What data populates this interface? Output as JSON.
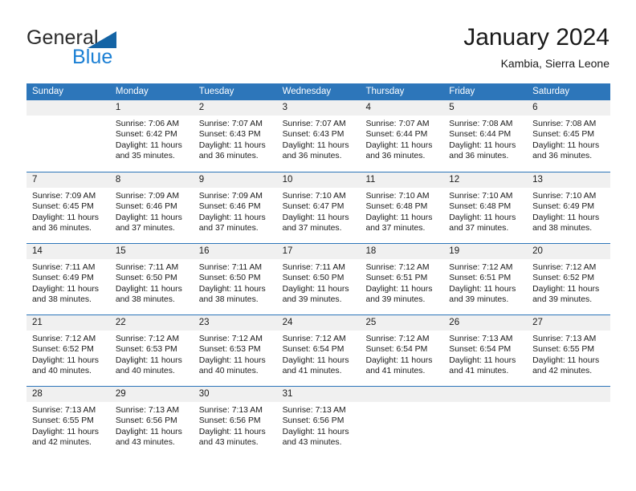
{
  "brand": {
    "line1": "General",
    "line2": "Blue",
    "triangle_color": "#1464a5",
    "line2_color": "#1a7fd4"
  },
  "header": {
    "title": "January 2024",
    "subtitle": "Kambia, Sierra Leone"
  },
  "colors": {
    "header_row_background": "#2d76ba",
    "header_row_text": "#ffffff",
    "day_number_band": "#f0f0f0",
    "week_divider": "#2d76ba",
    "body_text": "#1a1a1a",
    "page_background": "#ffffff"
  },
  "weekday_headers": [
    "Sunday",
    "Monday",
    "Tuesday",
    "Wednesday",
    "Thursday",
    "Friday",
    "Saturday"
  ],
  "weeks": [
    [
      {
        "day": "",
        "lines": []
      },
      {
        "day": "1",
        "lines": [
          "Sunrise: 7:06 AM",
          "Sunset: 6:42 PM",
          "Daylight: 11 hours",
          "and 35 minutes."
        ]
      },
      {
        "day": "2",
        "lines": [
          "Sunrise: 7:07 AM",
          "Sunset: 6:43 PM",
          "Daylight: 11 hours",
          "and 36 minutes."
        ]
      },
      {
        "day": "3",
        "lines": [
          "Sunrise: 7:07 AM",
          "Sunset: 6:43 PM",
          "Daylight: 11 hours",
          "and 36 minutes."
        ]
      },
      {
        "day": "4",
        "lines": [
          "Sunrise: 7:07 AM",
          "Sunset: 6:44 PM",
          "Daylight: 11 hours",
          "and 36 minutes."
        ]
      },
      {
        "day": "5",
        "lines": [
          "Sunrise: 7:08 AM",
          "Sunset: 6:44 PM",
          "Daylight: 11 hours",
          "and 36 minutes."
        ]
      },
      {
        "day": "6",
        "lines": [
          "Sunrise: 7:08 AM",
          "Sunset: 6:45 PM",
          "Daylight: 11 hours",
          "and 36 minutes."
        ]
      }
    ],
    [
      {
        "day": "7",
        "lines": [
          "Sunrise: 7:09 AM",
          "Sunset: 6:45 PM",
          "Daylight: 11 hours",
          "and 36 minutes."
        ]
      },
      {
        "day": "8",
        "lines": [
          "Sunrise: 7:09 AM",
          "Sunset: 6:46 PM",
          "Daylight: 11 hours",
          "and 37 minutes."
        ]
      },
      {
        "day": "9",
        "lines": [
          "Sunrise: 7:09 AM",
          "Sunset: 6:46 PM",
          "Daylight: 11 hours",
          "and 37 minutes."
        ]
      },
      {
        "day": "10",
        "lines": [
          "Sunrise: 7:10 AM",
          "Sunset: 6:47 PM",
          "Daylight: 11 hours",
          "and 37 minutes."
        ]
      },
      {
        "day": "11",
        "lines": [
          "Sunrise: 7:10 AM",
          "Sunset: 6:48 PM",
          "Daylight: 11 hours",
          "and 37 minutes."
        ]
      },
      {
        "day": "12",
        "lines": [
          "Sunrise: 7:10 AM",
          "Sunset: 6:48 PM",
          "Daylight: 11 hours",
          "and 37 minutes."
        ]
      },
      {
        "day": "13",
        "lines": [
          "Sunrise: 7:10 AM",
          "Sunset: 6:49 PM",
          "Daylight: 11 hours",
          "and 38 minutes."
        ]
      }
    ],
    [
      {
        "day": "14",
        "lines": [
          "Sunrise: 7:11 AM",
          "Sunset: 6:49 PM",
          "Daylight: 11 hours",
          "and 38 minutes."
        ]
      },
      {
        "day": "15",
        "lines": [
          "Sunrise: 7:11 AM",
          "Sunset: 6:50 PM",
          "Daylight: 11 hours",
          "and 38 minutes."
        ]
      },
      {
        "day": "16",
        "lines": [
          "Sunrise: 7:11 AM",
          "Sunset: 6:50 PM",
          "Daylight: 11 hours",
          "and 38 minutes."
        ]
      },
      {
        "day": "17",
        "lines": [
          "Sunrise: 7:11 AM",
          "Sunset: 6:50 PM",
          "Daylight: 11 hours",
          "and 39 minutes."
        ]
      },
      {
        "day": "18",
        "lines": [
          "Sunrise: 7:12 AM",
          "Sunset: 6:51 PM",
          "Daylight: 11 hours",
          "and 39 minutes."
        ]
      },
      {
        "day": "19",
        "lines": [
          "Sunrise: 7:12 AM",
          "Sunset: 6:51 PM",
          "Daylight: 11 hours",
          "and 39 minutes."
        ]
      },
      {
        "day": "20",
        "lines": [
          "Sunrise: 7:12 AM",
          "Sunset: 6:52 PM",
          "Daylight: 11 hours",
          "and 39 minutes."
        ]
      }
    ],
    [
      {
        "day": "21",
        "lines": [
          "Sunrise: 7:12 AM",
          "Sunset: 6:52 PM",
          "Daylight: 11 hours",
          "and 40 minutes."
        ]
      },
      {
        "day": "22",
        "lines": [
          "Sunrise: 7:12 AM",
          "Sunset: 6:53 PM",
          "Daylight: 11 hours",
          "and 40 minutes."
        ]
      },
      {
        "day": "23",
        "lines": [
          "Sunrise: 7:12 AM",
          "Sunset: 6:53 PM",
          "Daylight: 11 hours",
          "and 40 minutes."
        ]
      },
      {
        "day": "24",
        "lines": [
          "Sunrise: 7:12 AM",
          "Sunset: 6:54 PM",
          "Daylight: 11 hours",
          "and 41 minutes."
        ]
      },
      {
        "day": "25",
        "lines": [
          "Sunrise: 7:12 AM",
          "Sunset: 6:54 PM",
          "Daylight: 11 hours",
          "and 41 minutes."
        ]
      },
      {
        "day": "26",
        "lines": [
          "Sunrise: 7:13 AM",
          "Sunset: 6:54 PM",
          "Daylight: 11 hours",
          "and 41 minutes."
        ]
      },
      {
        "day": "27",
        "lines": [
          "Sunrise: 7:13 AM",
          "Sunset: 6:55 PM",
          "Daylight: 11 hours",
          "and 42 minutes."
        ]
      }
    ],
    [
      {
        "day": "28",
        "lines": [
          "Sunrise: 7:13 AM",
          "Sunset: 6:55 PM",
          "Daylight: 11 hours",
          "and 42 minutes."
        ]
      },
      {
        "day": "29",
        "lines": [
          "Sunrise: 7:13 AM",
          "Sunset: 6:56 PM",
          "Daylight: 11 hours",
          "and 43 minutes."
        ]
      },
      {
        "day": "30",
        "lines": [
          "Sunrise: 7:13 AM",
          "Sunset: 6:56 PM",
          "Daylight: 11 hours",
          "and 43 minutes."
        ]
      },
      {
        "day": "31",
        "lines": [
          "Sunrise: 7:13 AM",
          "Sunset: 6:56 PM",
          "Daylight: 11 hours",
          "and 43 minutes."
        ]
      },
      {
        "day": "",
        "lines": []
      },
      {
        "day": "",
        "lines": []
      },
      {
        "day": "",
        "lines": []
      }
    ]
  ]
}
